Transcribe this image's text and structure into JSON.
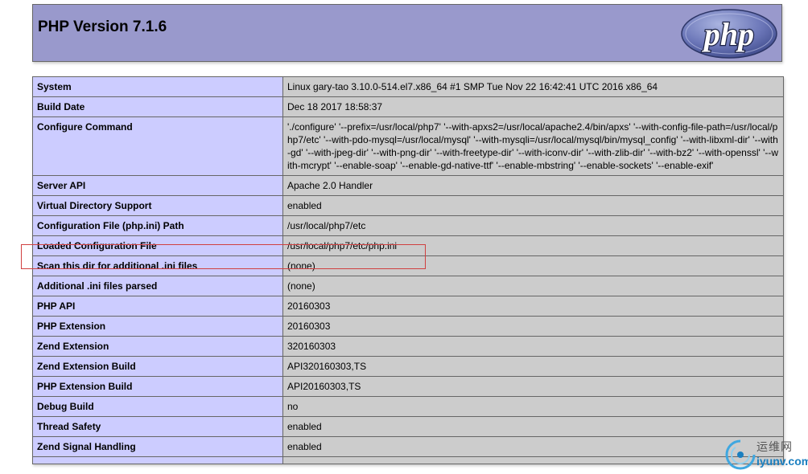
{
  "header": {
    "title": "PHP Version 7.1.6",
    "logo_text": "php"
  },
  "rows": [
    {
      "key": "System",
      "value": "Linux gary-tao 3.10.0-514.el7.x86_64 #1 SMP Tue Nov 22 16:42:41 UTC 2016 x86_64"
    },
    {
      "key": "Build Date",
      "value": "Dec 18 2017 18:58:37"
    },
    {
      "key": "Configure Command",
      "value": "'./configure' '--prefix=/usr/local/php7' '--with-apxs2=/usr/local/apache2.4/bin/apxs' '--with-config-file-path=/usr/local/php7/etc' '--with-pdo-mysql=/usr/local/mysql' '--with-mysqli=/usr/local/mysql/bin/mysql_config' '--with-libxml-dir' '--with-gd' '--with-jpeg-dir' '--with-png-dir' '--with-freetype-dir' '--with-iconv-dir' '--with-zlib-dir' '--with-bz2' '--with-openssl' '--with-mcrypt' '--enable-soap' '--enable-gd-native-ttf' '--enable-mbstring' '--enable-sockets' '--enable-exif'"
    },
    {
      "key": "Server API",
      "value": "Apache 2.0 Handler"
    },
    {
      "key": "Virtual Directory Support",
      "value": "enabled"
    },
    {
      "key": "Configuration File (php.ini) Path",
      "value": "/usr/local/php7/etc"
    },
    {
      "key": "Loaded Configuration File",
      "value": "/usr/local/php7/etc/php.ini"
    },
    {
      "key": "Scan this dir for additional .ini files",
      "value": "(none)"
    },
    {
      "key": "Additional .ini files parsed",
      "value": "(none)"
    },
    {
      "key": "PHP API",
      "value": "20160303"
    },
    {
      "key": "PHP Extension",
      "value": "20160303"
    },
    {
      "key": "Zend Extension",
      "value": "320160303"
    },
    {
      "key": "Zend Extension Build",
      "value": "API320160303,TS"
    },
    {
      "key": "PHP Extension Build",
      "value": "API20160303,TS"
    },
    {
      "key": "Debug Build",
      "value": "no"
    },
    {
      "key": "Thread Safety",
      "value": "enabled"
    },
    {
      "key": "Zend Signal Handling",
      "value": "enabled"
    },
    {
      "key": "",
      "value": ""
    }
  ],
  "watermark": {
    "cn": "运维网",
    "en": "iyunv.com"
  },
  "colors": {
    "header_bg": "#9999cc",
    "key_bg": "#ccccff",
    "value_bg": "#cccccc",
    "highlight": "#d04040"
  }
}
